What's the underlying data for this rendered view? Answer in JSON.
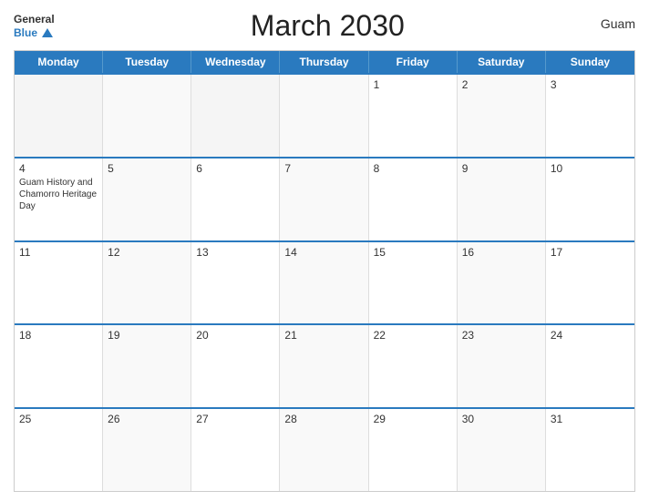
{
  "header": {
    "logo_general": "General",
    "logo_blue": "Blue",
    "title": "March 2030",
    "region": "Guam"
  },
  "calendar": {
    "days_of_week": [
      "Monday",
      "Tuesday",
      "Wednesday",
      "Thursday",
      "Friday",
      "Saturday",
      "Sunday"
    ],
    "weeks": [
      [
        {
          "day": "",
          "empty": true
        },
        {
          "day": "",
          "empty": true
        },
        {
          "day": "",
          "empty": true
        },
        {
          "day": "",
          "empty": true
        },
        {
          "day": "1",
          "empty": false
        },
        {
          "day": "2",
          "empty": false,
          "alt": true
        },
        {
          "day": "3",
          "empty": false
        }
      ],
      [
        {
          "day": "4",
          "empty": false,
          "event": "Guam History and Chamorro Heritage Day"
        },
        {
          "day": "5",
          "empty": false,
          "alt": true
        },
        {
          "day": "6",
          "empty": false
        },
        {
          "day": "7",
          "empty": false,
          "alt": true
        },
        {
          "day": "8",
          "empty": false
        },
        {
          "day": "9",
          "empty": false,
          "alt": true
        },
        {
          "day": "10",
          "empty": false
        }
      ],
      [
        {
          "day": "11",
          "empty": false
        },
        {
          "day": "12",
          "empty": false,
          "alt": true
        },
        {
          "day": "13",
          "empty": false
        },
        {
          "day": "14",
          "empty": false,
          "alt": true
        },
        {
          "day": "15",
          "empty": false
        },
        {
          "day": "16",
          "empty": false,
          "alt": true
        },
        {
          "day": "17",
          "empty": false
        }
      ],
      [
        {
          "day": "18",
          "empty": false
        },
        {
          "day": "19",
          "empty": false,
          "alt": true
        },
        {
          "day": "20",
          "empty": false
        },
        {
          "day": "21",
          "empty": false,
          "alt": true
        },
        {
          "day": "22",
          "empty": false
        },
        {
          "day": "23",
          "empty": false,
          "alt": true
        },
        {
          "day": "24",
          "empty": false
        }
      ],
      [
        {
          "day": "25",
          "empty": false
        },
        {
          "day": "26",
          "empty": false,
          "alt": true
        },
        {
          "day": "27",
          "empty": false
        },
        {
          "day": "28",
          "empty": false,
          "alt": true
        },
        {
          "day": "29",
          "empty": false
        },
        {
          "day": "30",
          "empty": false,
          "alt": true
        },
        {
          "day": "31",
          "empty": false
        }
      ]
    ]
  }
}
